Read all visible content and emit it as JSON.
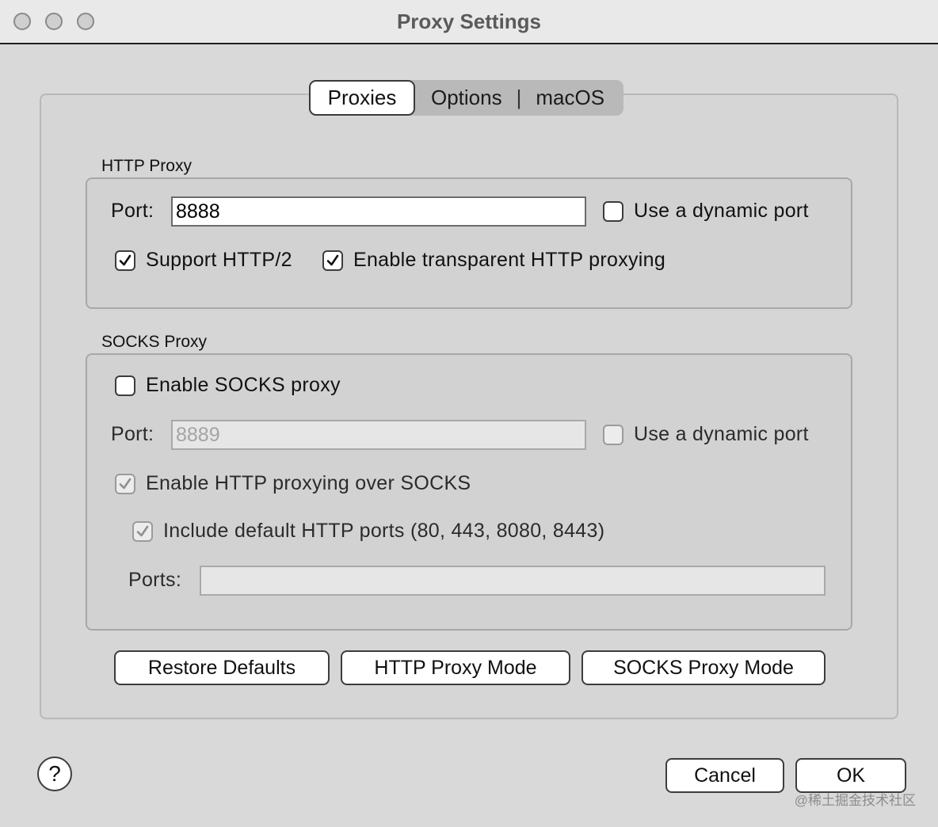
{
  "window": {
    "title": "Proxy Settings"
  },
  "tabs": [
    {
      "label": "Proxies",
      "active": true
    },
    {
      "label": "Options",
      "active": false
    },
    {
      "label": "macOS",
      "active": false
    }
  ],
  "tab_separator": "|",
  "http_proxy": {
    "title": "HTTP Proxy",
    "port_label": "Port:",
    "port_value": "8888",
    "dynamic_port_label": "Use a dynamic port",
    "dynamic_port_checked": false,
    "support_http2_label": "Support HTTP/2",
    "support_http2_checked": true,
    "transparent_label": "Enable transparent HTTP proxying",
    "transparent_checked": true
  },
  "socks_proxy": {
    "title": "SOCKS Proxy",
    "enable_label": "Enable SOCKS proxy",
    "enable_checked": false,
    "port_label": "Port:",
    "port_value": "8889",
    "dynamic_port_label": "Use a dynamic port",
    "dynamic_port_checked": false,
    "http_over_socks_label": "Enable HTTP proxying over SOCKS",
    "http_over_socks_checked": true,
    "include_default_ports_label": "Include default HTTP ports (80, 443, 8080, 8443)",
    "include_default_ports_checked": true,
    "ports_label": "Ports:",
    "ports_value": ""
  },
  "mode_buttons": {
    "restore_defaults": "Restore Defaults",
    "http_proxy_mode": "HTTP Proxy Mode",
    "socks_proxy_mode": "SOCKS Proxy Mode"
  },
  "footer": {
    "help": "?",
    "cancel": "Cancel",
    "ok": "OK"
  },
  "watermark": "@稀土掘金技术社区",
  "colors": {
    "window_bg": "#d9d9d9",
    "titlebar_bg": "#e9e9e9",
    "title_text": "#5a5a5a",
    "inactive_tab_bg": "#b9b9b9"
  }
}
